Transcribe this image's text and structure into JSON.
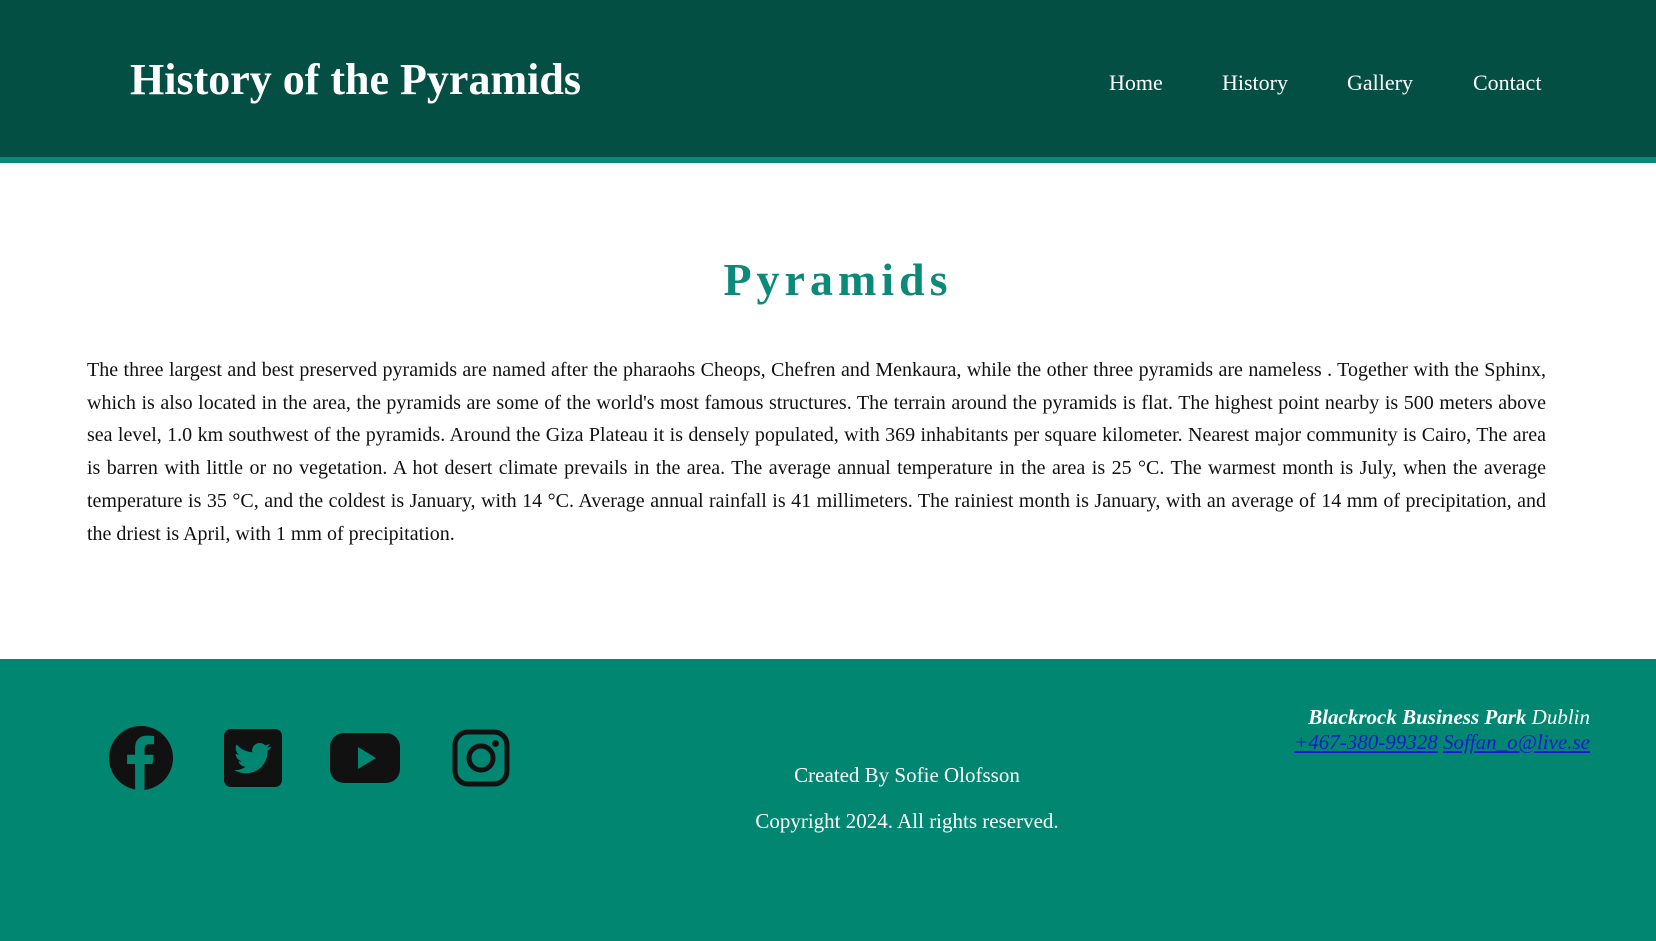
{
  "header": {
    "title": "History of the Pyramids",
    "nav": [
      {
        "label": "Home"
      },
      {
        "label": "History"
      },
      {
        "label": "Gallery"
      },
      {
        "label": "Contact"
      }
    ]
  },
  "main": {
    "heading": "Pyramids",
    "paragraph": "The three largest and best preserved pyramids are named after the pharaohs Cheops, Chefren and Menkaura, while the other three pyramids are nameless . Together with the Sphinx, which is also located in the area, the pyramids are some of the world's most famous structures. The terrain around the pyramids is flat. The highest point nearby is 500 meters above sea level, 1.0 km southwest of the pyramids. Around the Giza Plateau it is densely populated, with 369 inhabitants per square kilometer. Nearest major community is Cairo, The area is barren with little or no vegetation. A hot desert climate prevails in the area. The average annual temperature in the area is 25 °C. The warmest month is July, when the average temperature is 35 °C, and the coldest is January, with 14 °C. Average annual rainfall is 41 millimeters. The rainiest month is January, with an average of 14 mm of precipitation, and the driest is April, with 1 mm of precipitation."
  },
  "footer": {
    "social_icons": [
      "facebook-icon",
      "twitter-icon",
      "youtube-icon",
      "instagram-icon"
    ],
    "created_by": "Created By Sofie Olofsson",
    "copyright": "Copyright 2024. All rights reserved.",
    "contact": {
      "company": "Blackrock Business Park",
      "city": "Dublin",
      "phone": "+467-380-99328",
      "email": "Soffan_o@live.se"
    }
  },
  "colors": {
    "header_bg": "#034f43",
    "header_border": "#098977",
    "heading": "#0b8a79",
    "footer_bg": "#008671",
    "link": "#1a1acc"
  }
}
